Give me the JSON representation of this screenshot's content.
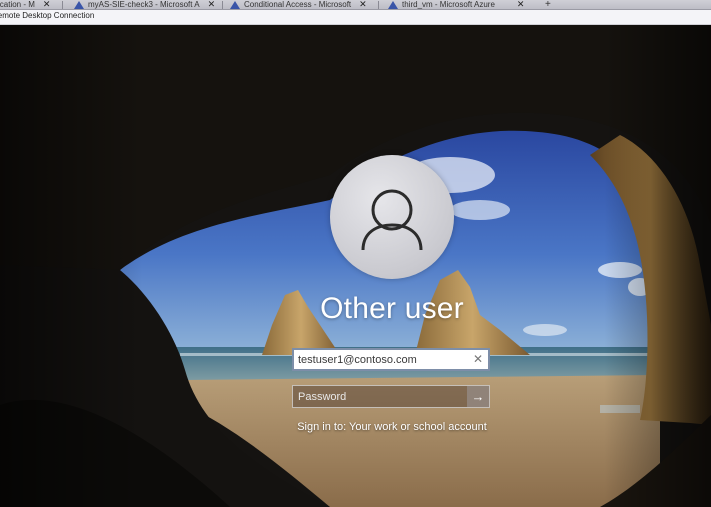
{
  "browser": {
    "tabs": [
      {
        "label": "ication - M",
        "close": "✕"
      },
      {
        "label": "myAS-SIE-check3 - Microsoft A",
        "close": "✕"
      },
      {
        "label": "Conditional Access - Microsoft",
        "close": "✕"
      },
      {
        "label": "third_vm - Microsoft Azure",
        "close": "✕"
      }
    ],
    "new_tab": "+"
  },
  "rdp_window": {
    "title": "Remote Desktop Connection"
  },
  "lock_screen": {
    "username": "Other user",
    "email_value": "testuser1@contoso.com",
    "clear_glyph": "✕",
    "password_placeholder": "Password",
    "submit_glyph": "→",
    "sign_in_to": "Sign in to: Your work or school account"
  },
  "colors": {
    "sky": "#3a63b8",
    "sea": "#4f7f95",
    "sand": "#a98a62",
    "cave": "#17140f"
  }
}
